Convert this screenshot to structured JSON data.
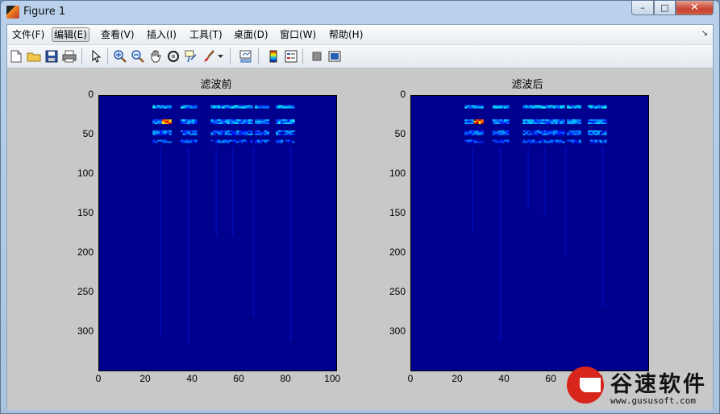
{
  "window": {
    "title": "Figure 1",
    "minimize": "–",
    "maximize": "□",
    "close": "✕"
  },
  "menu": {
    "items": [
      "文件(F)",
      "编辑(E)",
      "查看(V)",
      "插入(I)",
      "工具(T)",
      "桌面(D)",
      "窗口(W)",
      "帮助(H)"
    ],
    "active_index": 1,
    "dock_arrow": "↘"
  },
  "toolbar": {
    "icons": [
      "new-file-icon",
      "open-folder-icon",
      "save-icon",
      "print-icon",
      "select-arrow-icon",
      "zoom-in-icon",
      "zoom-out-icon",
      "pan-hand-icon",
      "rotate-3d-icon",
      "data-cursor-icon",
      "brush-icon",
      "brush-dropdown-icon",
      "link-plot-icon",
      "colorbar-icon",
      "legend-icon",
      "hide-plot-tools-icon",
      "show-plot-tools-icon"
    ]
  },
  "chart_data": [
    {
      "type": "heatmap",
      "title": "滤波前",
      "xlabel": "",
      "ylabel": "",
      "xticks": [
        "0",
        "20",
        "40",
        "60",
        "80",
        "100"
      ],
      "yticks": [
        "0",
        "50",
        "100",
        "150",
        "200",
        "250",
        "300"
      ],
      "xlim": [
        0,
        102
      ],
      "ylim": [
        0,
        350
      ],
      "colormap": "jet",
      "grid": false
    },
    {
      "type": "heatmap",
      "title": "滤波后",
      "xlabel": "",
      "ylabel": "",
      "xticks": [
        "0",
        "20",
        "40",
        "60",
        "80"
      ],
      "yticks": [
        "0",
        "50",
        "100",
        "150",
        "200",
        "250",
        "300"
      ],
      "xlim": [
        0,
        102
      ],
      "ylim": [
        0,
        350
      ],
      "colormap": "jet",
      "grid": false
    }
  ],
  "watermark": {
    "text": "谷速软件",
    "url": "www.gususoft.com"
  }
}
